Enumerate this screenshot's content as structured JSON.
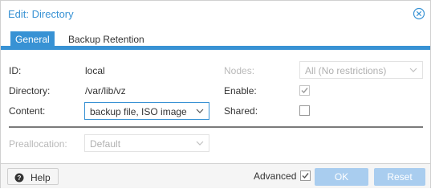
{
  "window": {
    "title": "Edit: Directory"
  },
  "tabs": [
    {
      "label": "General",
      "active": true
    },
    {
      "label": "Backup Retention",
      "active": false
    }
  ],
  "form": {
    "id_label": "ID:",
    "id_value": "local",
    "directory_label": "Directory:",
    "directory_value": "/var/lib/vz",
    "content_label": "Content:",
    "content_value": "backup file, ISO image",
    "nodes_label": "Nodes:",
    "nodes_value": "All (No restrictions)",
    "enable_label": "Enable:",
    "enable_checked": true,
    "shared_label": "Shared:",
    "shared_checked": false,
    "preallocation_label": "Preallocation:",
    "preallocation_value": "Default"
  },
  "footer": {
    "help_label": "Help",
    "advanced_label": "Advanced",
    "advanced_checked": true,
    "ok_label": "OK",
    "reset_label": "Reset"
  },
  "colors": {
    "accent": "#3892d4",
    "button_disabled": "#a9cdef"
  }
}
